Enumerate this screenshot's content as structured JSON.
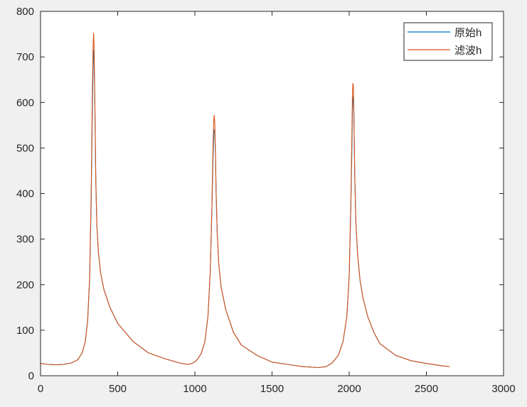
{
  "chart_data": {
    "type": "line",
    "title": "",
    "xlabel": "",
    "ylabel": "",
    "xlim": [
      0,
      3000
    ],
    "ylim": [
      0,
      800
    ],
    "xticks": [
      0,
      500,
      1000,
      1500,
      2000,
      2500,
      3000
    ],
    "yticks": [
      0,
      100,
      200,
      300,
      400,
      500,
      600,
      700,
      800
    ],
    "grid": false,
    "legend_position": "top-right",
    "series": [
      {
        "name": "原始h",
        "color": "#0072BD",
        "x": [
          0,
          50,
          100,
          150,
          200,
          240,
          270,
          290,
          305,
          318,
          328,
          336,
          341,
          344,
          347,
          352,
          358,
          365,
          375,
          390,
          410,
          450,
          500,
          600,
          700,
          800,
          900,
          950,
          980,
          1010,
          1040,
          1065,
          1085,
          1100,
          1110,
          1118,
          1123,
          1126,
          1129,
          1133,
          1138,
          1145,
          1155,
          1170,
          1200,
          1250,
          1300,
          1400,
          1500,
          1600,
          1700,
          1800,
          1850,
          1890,
          1930,
          1960,
          1985,
          2000,
          2010,
          2017,
          2021,
          2024,
          2027,
          2031,
          2036,
          2043,
          2055,
          2070,
          2090,
          2120,
          2160,
          2200,
          2300,
          2400,
          2500,
          2600,
          2650
        ],
        "y": [
          27,
          25,
          24,
          25,
          28,
          35,
          50,
          75,
          120,
          210,
          380,
          590,
          690,
          715,
          690,
          590,
          430,
          330,
          270,
          225,
          190,
          150,
          115,
          75,
          50,
          38,
          28,
          25,
          27,
          33,
          48,
          75,
          130,
          230,
          360,
          480,
          535,
          540,
          535,
          490,
          400,
          310,
          245,
          195,
          145,
          95,
          68,
          45,
          30,
          25,
          20,
          18,
          20,
          28,
          45,
          75,
          130,
          220,
          360,
          490,
          585,
          612,
          612,
          560,
          440,
          340,
          265,
          210,
          170,
          130,
          95,
          70,
          45,
          33,
          27,
          22,
          20
        ]
      },
      {
        "name": "滤波h",
        "color": "#D95319",
        "x": [
          0,
          50,
          100,
          150,
          200,
          240,
          270,
          290,
          305,
          318,
          328,
          336,
          341,
          344,
          347,
          352,
          358,
          365,
          375,
          390,
          410,
          450,
          500,
          600,
          700,
          800,
          900,
          950,
          980,
          1010,
          1040,
          1065,
          1085,
          1100,
          1110,
          1118,
          1123,
          1126,
          1129,
          1133,
          1138,
          1145,
          1155,
          1170,
          1200,
          1250,
          1300,
          1400,
          1500,
          1600,
          1700,
          1800,
          1850,
          1890,
          1930,
          1960,
          1985,
          2000,
          2010,
          2017,
          2021,
          2024,
          2027,
          2031,
          2036,
          2043,
          2055,
          2070,
          2090,
          2120,
          2160,
          2200,
          2300,
          2400,
          2500,
          2600,
          2650
        ],
        "y": [
          27,
          25,
          24,
          25,
          28,
          35,
          50,
          75,
          120,
          215,
          400,
          630,
          730,
          752,
          725,
          600,
          430,
          330,
          270,
          225,
          190,
          150,
          115,
          75,
          50,
          38,
          28,
          25,
          27,
          33,
          48,
          75,
          130,
          230,
          370,
          510,
          565,
          572,
          555,
          495,
          400,
          310,
          245,
          195,
          145,
          95,
          68,
          45,
          30,
          25,
          20,
          18,
          20,
          28,
          45,
          75,
          130,
          220,
          370,
          520,
          620,
          642,
          635,
          570,
          440,
          340,
          265,
          210,
          170,
          130,
          95,
          70,
          45,
          33,
          27,
          22,
          20
        ]
      }
    ]
  }
}
